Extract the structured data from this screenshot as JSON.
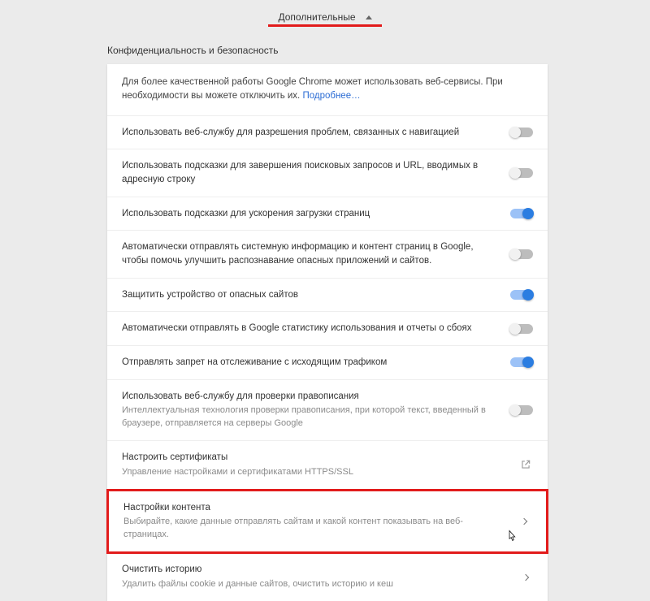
{
  "header": {
    "advanced_label": "Дополнительные"
  },
  "section": {
    "title": "Конфиденциальность и безопасность"
  },
  "intro": {
    "text_before": "Для более качественной работы Google Chrome может использовать веб-сервисы. При необходимости вы можете отключить их. ",
    "link_text": "Подробнее…"
  },
  "rows": [
    {
      "title": "Использовать веб-службу для разрешения проблем, связанных с навигацией",
      "sub": "",
      "type": "toggle",
      "on": false
    },
    {
      "title": "Использовать подсказки для завершения поисковых запросов и URL, вводимых в адресную строку",
      "sub": "",
      "type": "toggle",
      "on": false
    },
    {
      "title": "Использовать подсказки для ускорения загрузки страниц",
      "sub": "",
      "type": "toggle",
      "on": true
    },
    {
      "title": "Автоматически отправлять системную информацию и контент страниц в Google, чтобы помочь улучшить распознавание опасных приложений и сайтов.",
      "sub": "",
      "type": "toggle",
      "on": false
    },
    {
      "title": "Защитить устройство от опасных сайтов",
      "sub": "",
      "type": "toggle",
      "on": true
    },
    {
      "title": "Автоматически отправлять в Google статистику использования и отчеты о сбоях",
      "sub": "",
      "type": "toggle",
      "on": false
    },
    {
      "title": "Отправлять запрет на отслеживание с исходящим трафиком",
      "sub": "",
      "type": "toggle",
      "on": true
    },
    {
      "title": "Использовать веб-службу для проверки правописания",
      "sub": "Интеллектуальная технология проверки правописания, при которой текст, введенный в браузере, отправляется на серверы Google",
      "type": "toggle",
      "on": false
    },
    {
      "title": "Настроить сертификаты",
      "sub": "Управление настройками и сертификатами HTTPS/SSL",
      "type": "external"
    },
    {
      "title": "Настройки контента",
      "sub": "Выбирайте, какие данные отправлять сайтам и какой контент показывать на веб-страницах.",
      "type": "link",
      "highlight": true
    },
    {
      "title": "Очистить историю",
      "sub": "Удалить файлы cookie и данные сайтов, очистить историю и кеш",
      "type": "link"
    }
  ]
}
